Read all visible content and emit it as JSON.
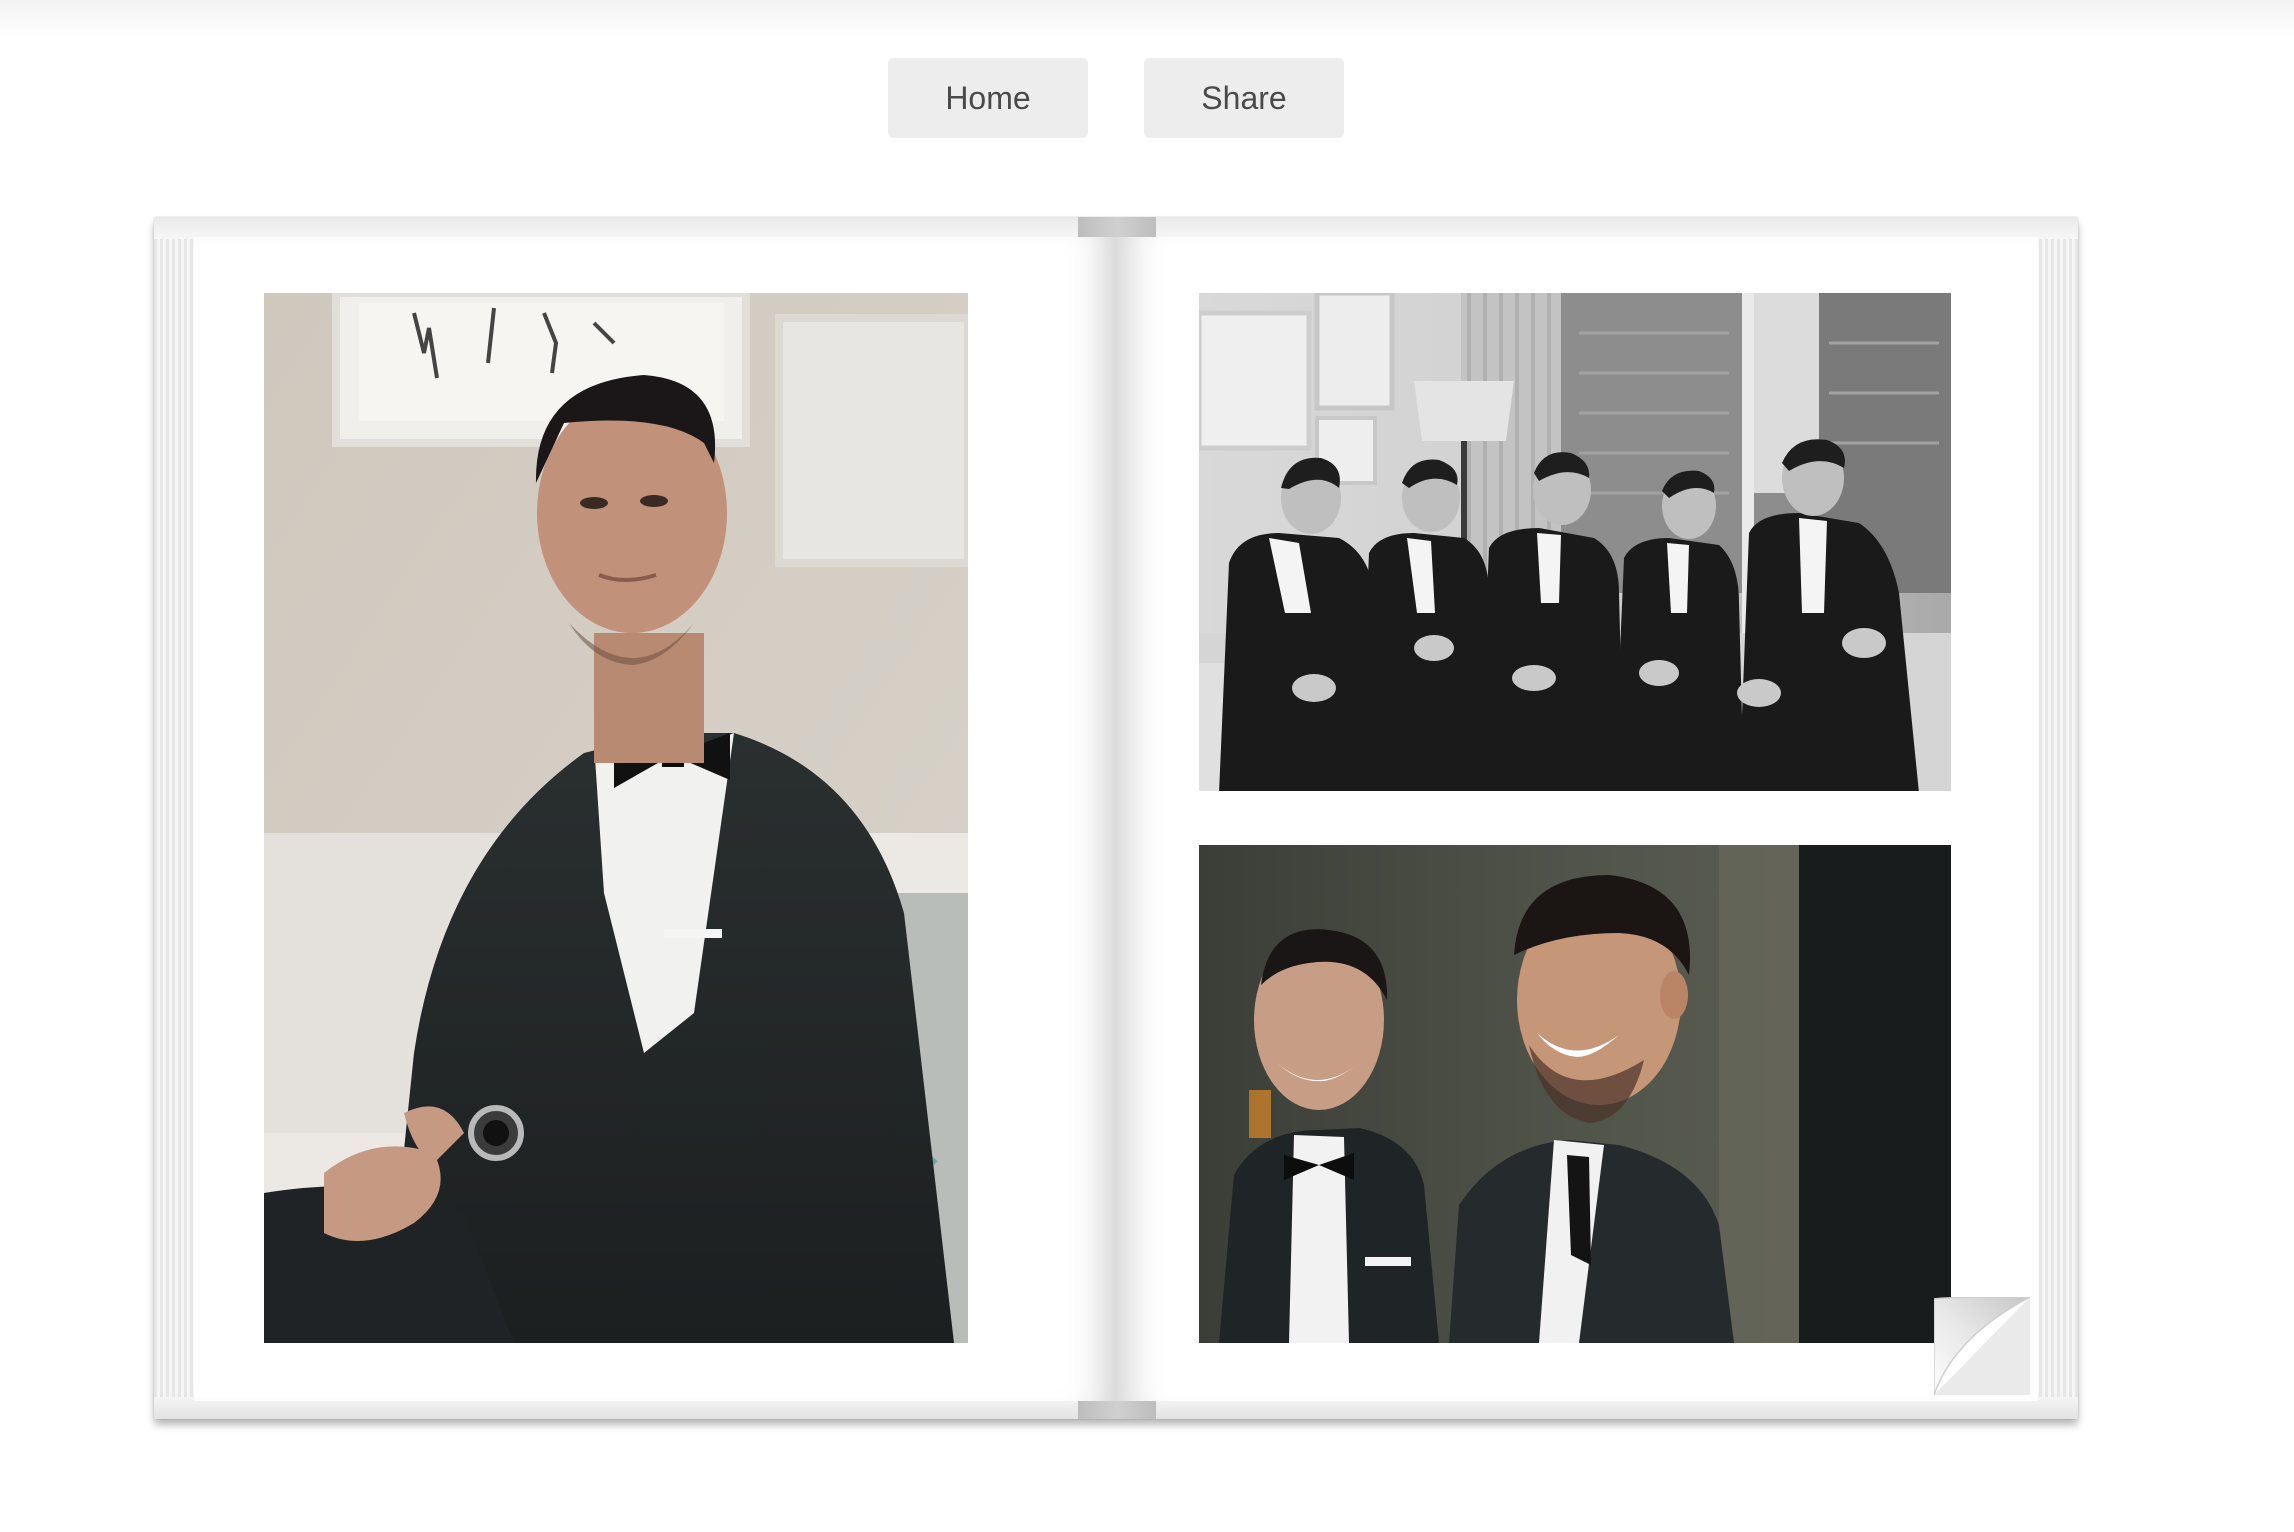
{
  "nav": {
    "home_label": "Home",
    "share_label": "Share"
  },
  "album": {
    "spread": {
      "left_page": {
        "photos": [
          {
            "subject": "groom-portrait-color",
            "icon": "photo-groom-portrait"
          }
        ]
      },
      "right_page": {
        "photos": [
          {
            "subject": "groomsmen-on-sofa-bw",
            "icon": "photo-groomsmen-group"
          },
          {
            "subject": "two-men-laughing-color",
            "icon": "photo-two-men-laughing"
          }
        ]
      }
    },
    "page_curl_icon": "page-curl-icon"
  },
  "colors": {
    "button_bg": "#ededed",
    "button_text": "#4a4a4a",
    "book_cover": "#cfcfcf",
    "page": "#ffffff"
  }
}
